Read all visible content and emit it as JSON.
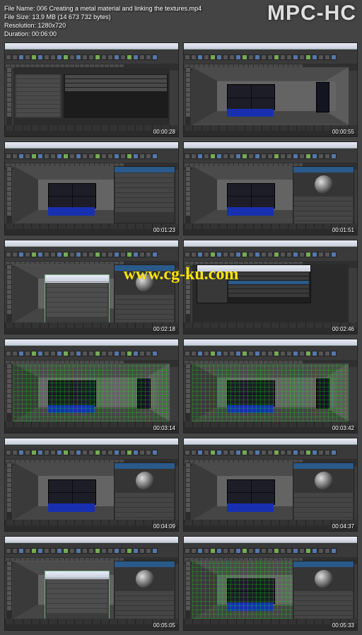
{
  "watermark": {
    "player": "MPC-HC",
    "site_url": "www.cg-ku.com"
  },
  "file_info": {
    "name_label": "File Name: ",
    "name": "006 Creating a metal material and linking the textures.mp4",
    "size_label": "File Size: ",
    "size": "13,9 MB (14 673 732 bytes)",
    "res_label": "Resolution: ",
    "res": "1280x720",
    "dur_label": "Duration: ",
    "dur": "00:06:00"
  },
  "thumbs": [
    {
      "ts": "00:00:28",
      "variant": "hypershade"
    },
    {
      "ts": "00:00:55",
      "variant": "room_plain"
    },
    {
      "ts": "00:01:23",
      "variant": "room_attr_panel"
    },
    {
      "ts": "00:01:51",
      "variant": "room_side_sphere"
    },
    {
      "ts": "00:02:18",
      "variant": "room_dialog"
    },
    {
      "ts": "00:02:46",
      "variant": "browser"
    },
    {
      "ts": "00:03:14",
      "variant": "room_green_grid"
    },
    {
      "ts": "00:03:42",
      "variant": "room_green_grid"
    },
    {
      "ts": "00:04:09",
      "variant": "room_side_sphere"
    },
    {
      "ts": "00:04:37",
      "variant": "room_side_sphere"
    },
    {
      "ts": "00:05:05",
      "variant": "room_dialog"
    },
    {
      "ts": "00:05:33",
      "variant": "room_side_sphere_green"
    }
  ]
}
